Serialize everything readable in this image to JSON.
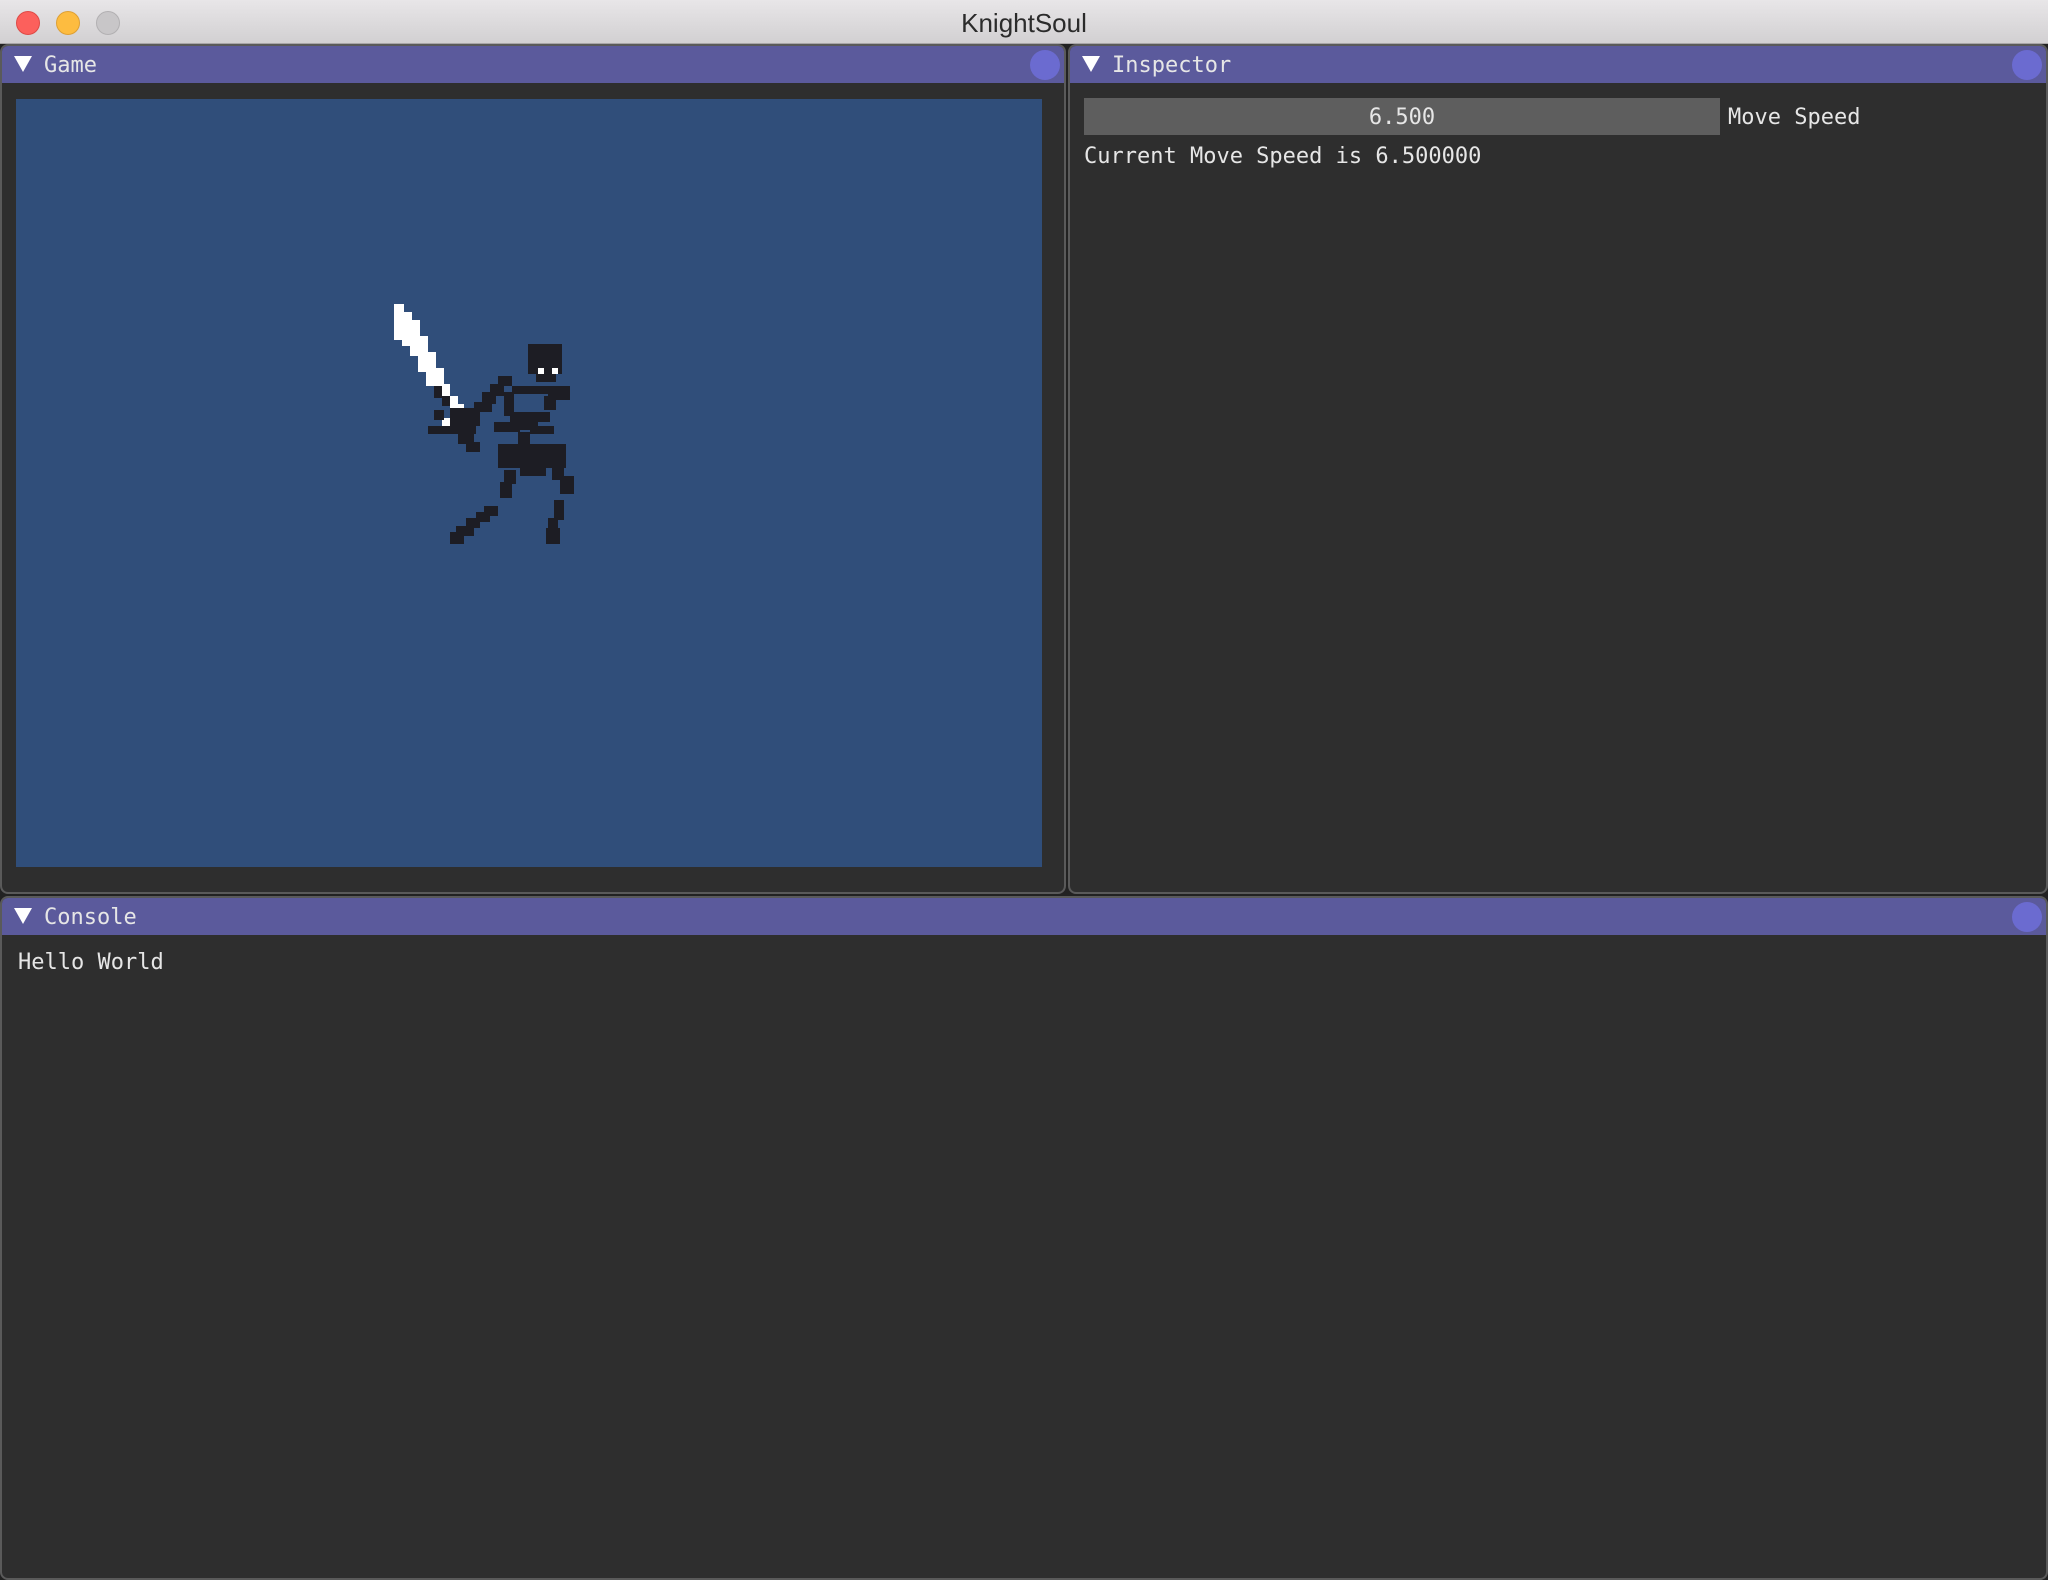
{
  "window": {
    "title": "KnightSoul"
  },
  "panels": {
    "game": {
      "title": "Game",
      "viewport_bg": "#304e7a",
      "sprite": "skeleton-knight-with-sword"
    },
    "inspector": {
      "title": "Inspector",
      "slider_value": "6.500",
      "slider_label": "Move Speed",
      "info_text": "Current Move Speed is 6.500000"
    },
    "console": {
      "title": "Console",
      "lines": [
        "Hello World"
      ]
    }
  },
  "colors": {
    "header": "#5b5a9c",
    "panel_bg": "#2e2e2e",
    "close_button": "#6b6bd0",
    "slider_bg": "#5e5e5e",
    "text": "#e6e6e6"
  },
  "icons": {
    "collapse": "triangle-down-icon",
    "close": "circle-close-icon"
  }
}
